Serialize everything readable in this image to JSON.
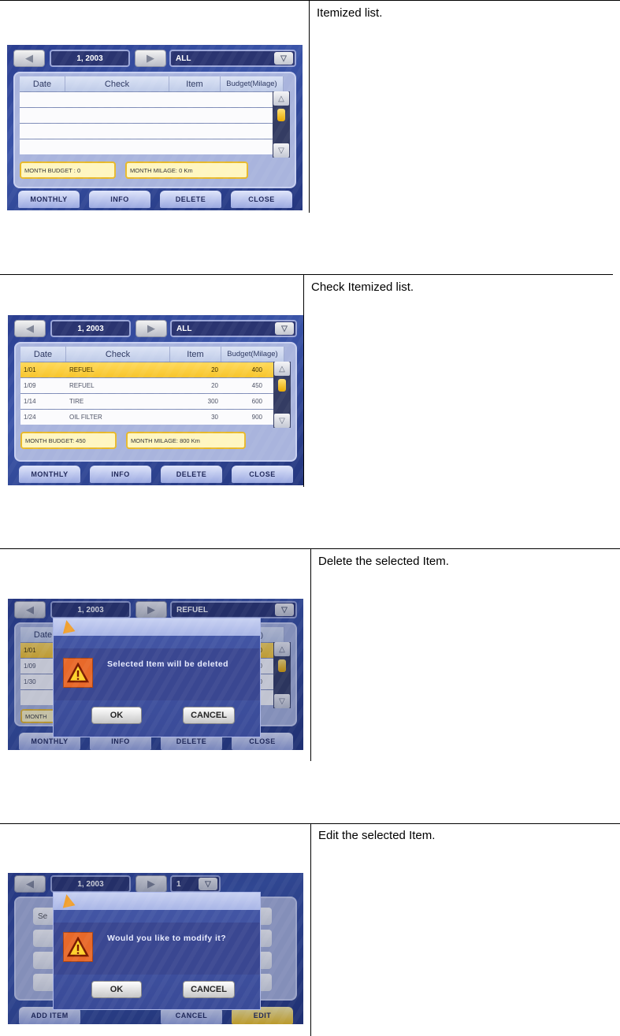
{
  "sections": [
    {
      "caption": "Itemized list.",
      "screen": {
        "month": "1, 2003",
        "filter": "ALL",
        "columns": [
          "Date",
          "Check",
          "Item",
          "Budget(Milage)"
        ],
        "rows": [],
        "month_budget": "MONTH BUDGET : 0",
        "month_milage": "MONTH MILAGE: 0 Km",
        "buttons": [
          "MONTHLY",
          "INFO",
          "DELETE",
          "CLOSE"
        ]
      }
    },
    {
      "caption": "Check Itemized list.",
      "screen": {
        "month": "1, 2003",
        "filter": "ALL",
        "columns": [
          "Date",
          "Check",
          "Item",
          "Budget(Milage)"
        ],
        "rows": [
          {
            "date": "1/01",
            "check": "REFUEL",
            "item": "20",
            "budget": "400",
            "selected": true
          },
          {
            "date": "1/09",
            "check": "REFUEL",
            "item": "20",
            "budget": "450",
            "selected": false
          },
          {
            "date": "1/14",
            "check": "TIRE",
            "item": "300",
            "budget": "600",
            "selected": false
          },
          {
            "date": "1/24",
            "check": "OIL FILTER",
            "item": "30",
            "budget": "900",
            "selected": false
          }
        ],
        "month_budget": "MONTH BUDGET: 450",
        "month_milage": "MONTH MILAGE: 800 Km",
        "buttons": [
          "MONTHLY",
          "INFO",
          "DELETE",
          "CLOSE"
        ]
      }
    },
    {
      "caption": "Delete the selected Item.",
      "screen": {
        "month": "1, 2003",
        "filter": "REFUEL",
        "column_partial_left": "Date",
        "column_partial_right": "Milage)",
        "rows": [
          {
            "date": "1/01",
            "budget_partial": "00",
            "selected": true
          },
          {
            "date": "1/09",
            "budget_partial": "50",
            "selected": false
          },
          {
            "date": "1/30",
            "budget_partial": "00",
            "selected": false
          },
          {
            "date": "",
            "budget_partial": "",
            "selected": false
          }
        ],
        "month_budget_partial": "MONTH",
        "buttons": [
          "MONTHLY",
          "INFO",
          "DELETE",
          "CLOSE"
        ],
        "dialog": {
          "message": "Selected Item will be deleted",
          "ok": "OK",
          "cancel": "CANCEL"
        }
      }
    },
    {
      "caption": "Edit the selected Item.",
      "screen": {
        "month": "1, 2003",
        "filter": "1",
        "field_partial": "Se",
        "buttons": [
          "ADD ITEM",
          "CANCEL",
          "EDIT"
        ],
        "dialog": {
          "message": "Would you like to modify it?",
          "ok": "OK",
          "cancel": "CANCEL"
        }
      }
    }
  ]
}
